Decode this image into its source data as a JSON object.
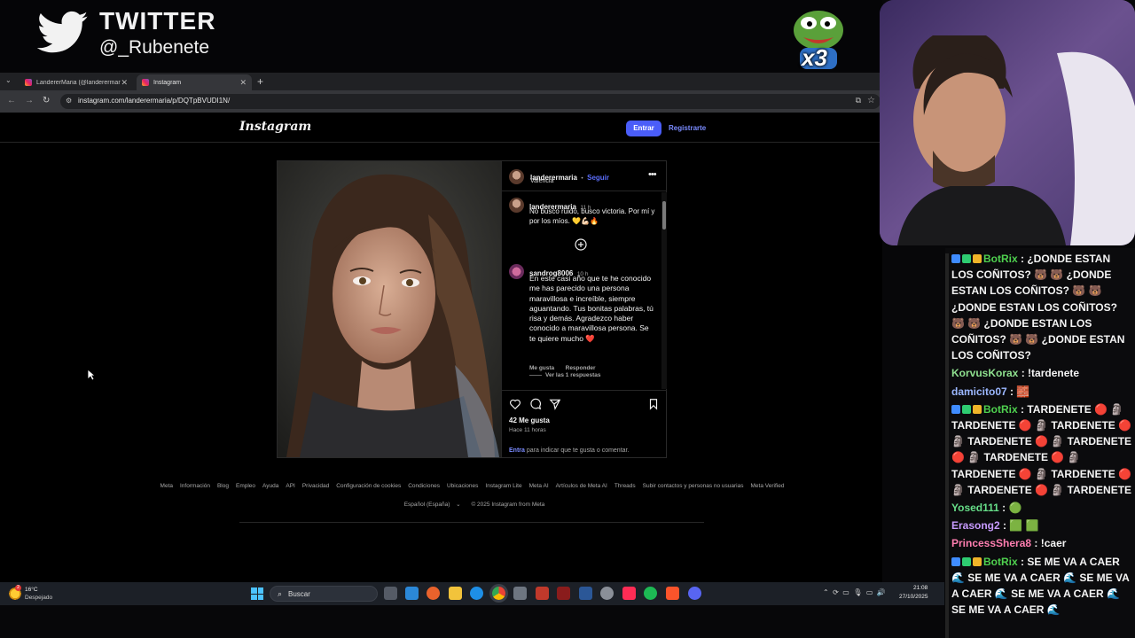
{
  "overlay": {
    "twitter_title": "TWITTER",
    "twitter_handle": "@_Rubenete",
    "emote_multiplier": "x3"
  },
  "browser": {
    "tabs": [
      {
        "label": "LandererMaria (@landerermaria)",
        "active": false
      },
      {
        "label": "Instagram",
        "active": true
      }
    ],
    "url": "instagram.com/landerermaria/p/DQTpBVUDI1N/"
  },
  "instagram": {
    "logo": "Instagram",
    "login_label": "Entrar",
    "register_label": "Registrarte",
    "post": {
      "username": "landerermaria",
      "follow_separator": "•",
      "follow_label": "Seguir",
      "location": "Valencia",
      "caption": {
        "username": "landerermaria",
        "time": "11 h",
        "text": "No busco ruido, busco victoria. Por mí y por los míos. 💛💪🏻🔥"
      },
      "comment": {
        "username": "sandrog8006",
        "time": "10 h",
        "text": "En este casi año que te he conocido me has parecido una persona maravillosa e increíble, siempre aguantando. Tus bonitas palabras, tú risa y demás. Agradezco haber conocido a maravillosa persona. Se te quiere mucho ❤️",
        "like_label": "Me gusta",
        "reply_label": "Responder",
        "view_replies": "Ver las 1 respuestas"
      },
      "likes": "42 Me gusta",
      "posted_ago": "Hace 11 horas",
      "login_prompt_link": "Entra",
      "login_prompt_text": "para indicar que te gusta o comentar."
    },
    "footer_links": [
      "Meta",
      "Información",
      "Blog",
      "Empleo",
      "Ayuda",
      "API",
      "Privacidad",
      "Configuración de cookies",
      "Condiciones",
      "Ubicaciones",
      "Instagram Lite",
      "Meta AI",
      "Artículos de Meta AI",
      "Threads",
      "Subir contactos y personas no usuarias",
      "Meta Verified"
    ],
    "language": "Español (España)",
    "copyright": "© 2025 Instagram from Meta"
  },
  "taskbar": {
    "weather_temp": "16°C",
    "weather_desc": "Despejado",
    "weather_badge": "2",
    "search_label": "Buscar",
    "time": "21:08",
    "date": "27/10/2025"
  },
  "chat": [
    {
      "user": "BotRix",
      "color": "#4fd14f",
      "badges": true,
      "sep": ":",
      "text": "¿DONDE ESTAN LOS COÑITOS? 🐻 🐻 ¿DONDE ESTAN LOS COÑITOS? 🐻 🐻 ¿DONDE ESTAN LOS COÑITOS? 🐻 🐻 ¿DONDE ESTAN LOS COÑITOS? 🐻 🐻 ¿DONDE ESTAN LOS COÑITOS?"
    },
    {
      "user": "KorvusKorax",
      "color": "#8fe08f",
      "badges": false,
      "sep": ":",
      "text": "!tardenete"
    },
    {
      "user": "damicito07",
      "color": "#9bb7ff",
      "badges": false,
      "sep": ":",
      "text": "🧱"
    },
    {
      "user": "BotRix",
      "color": "#4fd14f",
      "badges": true,
      "sep": ":",
      "text": "TARDENETE 🔴 🗿 TARDENETE 🔴 🗿 TARDENETE 🔴 🗿 TARDENETE 🔴 🗿 TARDENETE 🔴 🗿 TARDENETE 🔴 🗿 TARDENETE 🔴 🗿 TARDENETE 🔴 🗿 TARDENETE 🔴 🗿 TARDENETE"
    },
    {
      "user": "Yosed111",
      "color": "#66dd88",
      "badges": false,
      "sep": ":",
      "text": "🟢"
    },
    {
      "user": "Erasong2",
      "color": "#c79bff",
      "badges": false,
      "sep": ":",
      "text": "🟩 🟩"
    },
    {
      "user": "PrincessShera8",
      "color": "#ff7eb0",
      "badges": false,
      "sep": ":",
      "text": "!caer"
    },
    {
      "user": "BotRix",
      "color": "#4fd14f",
      "badges": true,
      "sep": ":",
      "text": "SE ME VA A CAER 🌊 SE ME VA A CAER 🌊 SE ME VA A CAER 🌊 SE ME VA A CAER 🌊 SE ME VA A CAER 🌊"
    }
  ]
}
